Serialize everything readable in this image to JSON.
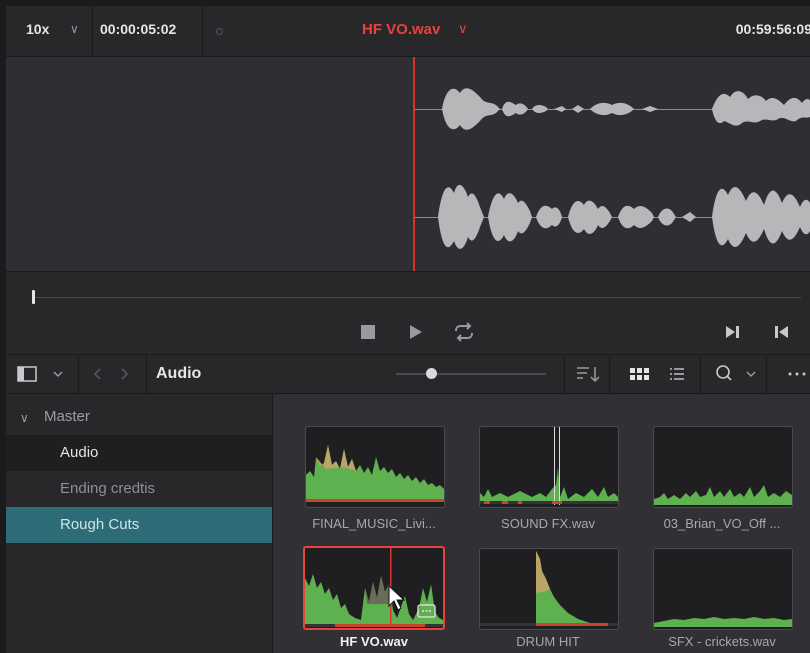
{
  "viewer": {
    "zoom": "10x",
    "timecode_in": "00:00:05:02",
    "clip_name": "HF VO.wav",
    "timecode_out": "00:59:56:09"
  },
  "media_pool": {
    "title": "Audio",
    "bins": [
      {
        "label": "Master"
      },
      {
        "label": "Audio"
      },
      {
        "label": "Ending credtis"
      },
      {
        "label": "Rough Cuts"
      }
    ],
    "clips": [
      {
        "name": "FINAL_MUSIC_Livi..."
      },
      {
        "name": "SOUND FX.wav"
      },
      {
        "name": "03_Brian_VO_Off ..."
      },
      {
        "name": "HF VO.wav"
      },
      {
        "name": "DRUM HIT"
      },
      {
        "name": "SFX - crickets.wav"
      }
    ]
  },
  "colors": {
    "accent_red": "#e8433a",
    "selected_bin": "#2d6c76",
    "waveform_green": "#5fb14f"
  }
}
